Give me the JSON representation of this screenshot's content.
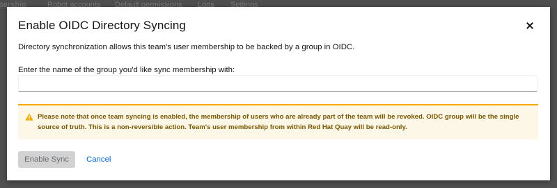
{
  "background": {
    "tabs": [
      {
        "label": "Team Membership",
        "active": true
      },
      {
        "label": "Robot accounts",
        "active": false
      },
      {
        "label": "Default permissions",
        "active": false
      },
      {
        "label": "Logs",
        "active": false
      },
      {
        "label": "Settings",
        "active": false
      }
    ]
  },
  "modal": {
    "title": "Enable OIDC Directory Syncing",
    "close_icon": "close-icon",
    "description": "Directory synchronization allows this team's user membership to be backed by a group in OIDC.",
    "field_label": "Enter the name of the group you'd like sync membership with:",
    "group_input": {
      "value": "",
      "placeholder": ""
    },
    "warning": {
      "icon": "warning-triangle-icon",
      "text": "Please note that once team syncing is enabled, the membership of users who are already part of the team will be revoked. OIDC group will be the single source of truth. This is a non-reversible action. Team's user membership from within Red Hat Quay will be read-only."
    },
    "buttons": {
      "enable_sync": "Enable Sync",
      "cancel": "Cancel"
    }
  },
  "colors": {
    "overlay": "#4f4f4f",
    "warning_border": "#f0ab00",
    "warning_background": "#fdf7e7",
    "warning_text": "#795600",
    "link": "#0066cc",
    "disabled_button": "#d2d2d2"
  }
}
